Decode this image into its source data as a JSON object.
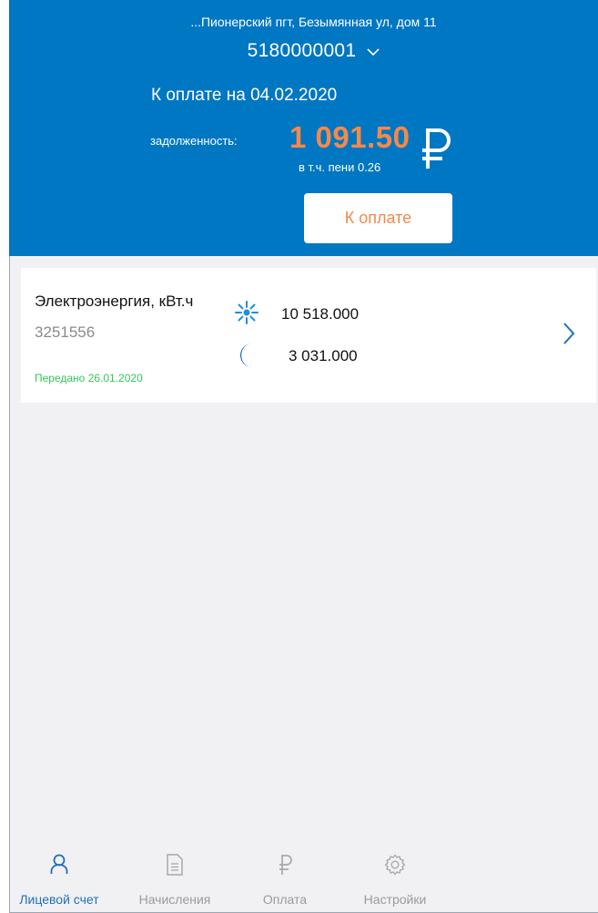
{
  "header": {
    "address": "...Пионерский пгт, Безымянная ул, дом 11",
    "account_number": "5180000001",
    "due_title": "К оплате на 04.02.2020",
    "debt_label": "задолженность:",
    "debt_amount": "1 091.50",
    "penalty": "в т.ч. пени 0.26",
    "currency_icon": "ruble-icon",
    "pay_button_label": "К оплате"
  },
  "meter": {
    "title": "Электроэнергия, кВт.ч",
    "serial": "3251556",
    "sent": "Передано 26.01.2020",
    "day_icon": "sun-icon",
    "day_value": "10 518.000",
    "night_icon": "moon-icon",
    "night_value": "3 031.000"
  },
  "nav": {
    "items": [
      {
        "label": "Лицевой счет",
        "icon": "user-icon",
        "active": true
      },
      {
        "label": "Начисления",
        "icon": "document-icon",
        "active": false
      },
      {
        "label": "Оплата",
        "icon": "ruble-icon",
        "active": false
      },
      {
        "label": "Настройки",
        "icon": "gear-icon",
        "active": false
      }
    ]
  },
  "colors": {
    "brand_blue": "#0077c2",
    "accent_orange": "#f4894b",
    "success_green": "#34c759",
    "nav_active": "#1f6fb8",
    "nav_inactive": "#9a9a9a",
    "background": "#f1f1f4"
  }
}
